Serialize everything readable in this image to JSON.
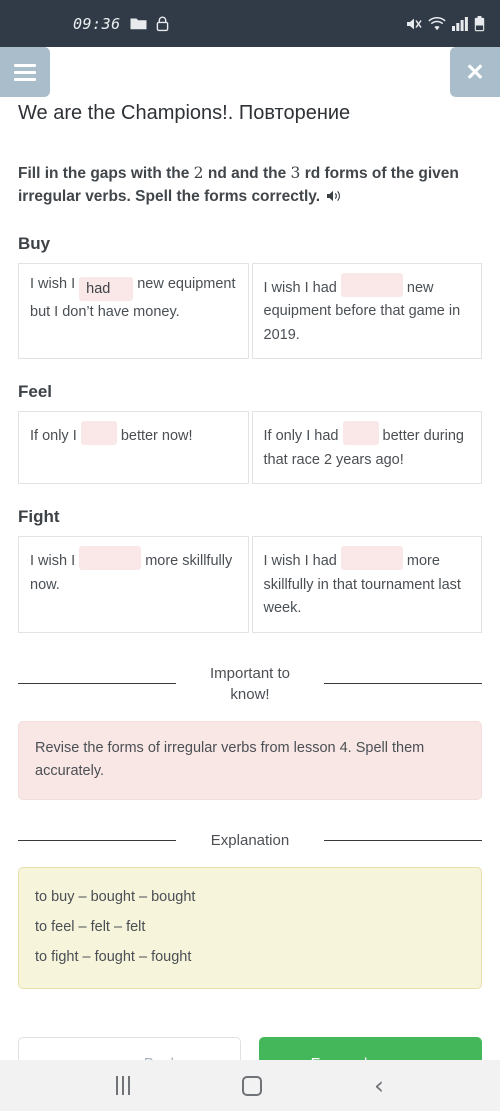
{
  "status_bar": {
    "clock": "09:36",
    "icons_left": [
      "folder-icon",
      "lock-icon"
    ],
    "icons_right": [
      "mute-icon",
      "wifi-icon",
      "signal-icon",
      "battery-icon"
    ],
    "background": "#313b47"
  },
  "header": {
    "menu_icon": "hamburger-icon",
    "close_label": "✕",
    "button_color": "#a9bdcb",
    "lesson_title": "We are the Champions!. Повторение"
  },
  "instruction": {
    "part1": "Fill in the gaps with the ",
    "num1": "2",
    "part2": " nd and the ",
    "num2": "3",
    "part3": " rd forms of the given irregular verbs. Spell the forms correctly.",
    "audio_icon": "speaker-icon"
  },
  "exercises": [
    {
      "verb": "Buy",
      "cells": [
        {
          "before": "I wish I",
          "input_value": "had",
          "input_placeholder": "",
          "after": "new equipment but I don’t have money."
        },
        {
          "before": "I wish I had",
          "input_value": "",
          "input_placeholder": "",
          "after": "new equipment before that game in 2019."
        }
      ]
    },
    {
      "verb": "Feel",
      "cells": [
        {
          "before": "If only I",
          "input_value": "",
          "input_placeholder": "",
          "after": "better now!"
        },
        {
          "before": "If only I had",
          "input_value": "",
          "input_placeholder": "",
          "after": "better during that race 2 years ago!"
        }
      ]
    },
    {
      "verb": "Fight",
      "cells": [
        {
          "before": "I wish I",
          "input_value": "",
          "input_placeholder": "",
          "after": "more skillfully now."
        },
        {
          "before": "I wish I had",
          "input_value": "",
          "input_placeholder": "",
          "after": "more skillfully in that tournament last week."
        }
      ]
    }
  ],
  "important": {
    "divider_label": "Important to know!",
    "text": "Revise the forms of irregular verbs from lesson 4. Spell them accurately.",
    "background": "#f9e7e5"
  },
  "explanation": {
    "divider_label": "Explanation",
    "lines": [
      "to buy – bought – bought",
      "to feel – felt – felt",
      "to fight – fought – fought"
    ],
    "background": "#f7f4dc"
  },
  "footer": {
    "back_label": "Back",
    "back_arrow": "←",
    "forward_label": "Forward",
    "forward_arrow": "→",
    "forward_color": "#45b75b"
  },
  "nav_bar": {
    "recent_icon": "recent-apps-icon",
    "home_icon": "home-icon",
    "back_icon": "back-icon"
  }
}
